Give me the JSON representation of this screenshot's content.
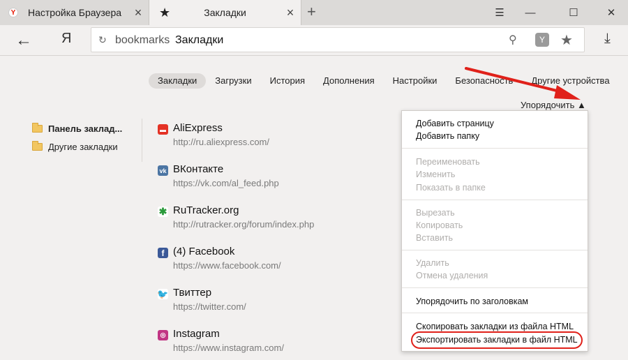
{
  "tabs": [
    {
      "title": "Настройка Браузера",
      "icon": "yandex-icon"
    },
    {
      "title": "Закладки",
      "icon": "star-icon"
    }
  ],
  "address": {
    "host": "bookmarks",
    "title": "Закладки"
  },
  "nav": [
    "Закладки",
    "Загрузки",
    "История",
    "Дополнения",
    "Настройки",
    "Безопасность",
    "Другие устройства"
  ],
  "sort_label": "Упорядочить",
  "folders": [
    "Панель заклад...",
    "Другие закладки"
  ],
  "bookmarks": [
    {
      "title": "AliExpress",
      "url": "http://ru.aliexpress.com/"
    },
    {
      "title": "ВКонтакте",
      "url": "https://vk.com/al_feed.php"
    },
    {
      "title": "RuTracker.org",
      "url": "http://rutracker.org/forum/index.php"
    },
    {
      "title": "(4) Facebook",
      "url": "https://www.facebook.com/"
    },
    {
      "title": "Твиттер",
      "url": "https://twitter.com/"
    },
    {
      "title": "Instagram",
      "url": "https://www.instagram.com/"
    }
  ],
  "menu": [
    {
      "label": "Добавить страницу",
      "enabled": true
    },
    {
      "label": "Добавить папку",
      "enabled": true
    },
    {
      "label": "Переименовать",
      "enabled": false
    },
    {
      "label": "Изменить",
      "enabled": false
    },
    {
      "label": "Показать в папке",
      "enabled": false
    },
    {
      "label": "Вырезать",
      "enabled": false
    },
    {
      "label": "Копировать",
      "enabled": false
    },
    {
      "label": "Вставить",
      "enabled": false
    },
    {
      "label": "Удалить",
      "enabled": false
    },
    {
      "label": "Отмена удаления",
      "enabled": false
    },
    {
      "label": "Упорядочить по заголовкам",
      "enabled": true
    },
    {
      "label": "Скопировать закладки из файла HTML",
      "enabled": true
    },
    {
      "label": "Экспортировать закладки в файл HTML",
      "enabled": true
    }
  ],
  "colors": {
    "annotation": "#e0211a",
    "folder": "#f2c661"
  }
}
